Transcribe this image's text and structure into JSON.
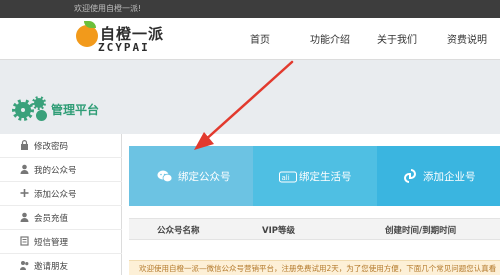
{
  "topbar": {
    "welcome": "欢迎使用自橙一派!"
  },
  "logo": {
    "name_cn": "自橙一派",
    "name_en": "ZCYPAI"
  },
  "nav": [
    "首页",
    "功能介绍",
    "关于我们",
    "资费说明"
  ],
  "panel": {
    "title": "管理平台"
  },
  "sidebar": {
    "items": [
      {
        "label": "修改密码",
        "icon": "lock-icon"
      },
      {
        "label": "我的公众号",
        "icon": "user-icon"
      },
      {
        "label": "添加公众号",
        "icon": "plus-icon"
      },
      {
        "label": "会员充值",
        "icon": "member-icon"
      },
      {
        "label": "短信管理",
        "icon": "sms-icon"
      },
      {
        "label": "邀请朋友",
        "icon": "invite-icon"
      }
    ]
  },
  "cards": [
    {
      "label": "绑定公众号",
      "icon": "wechat-icon",
      "color": "#6cc3e3"
    },
    {
      "label": "绑定生活号",
      "icon": "alipay-icon",
      "color": "#4fbfe3"
    },
    {
      "label": "添加企业号",
      "icon": "link-icon",
      "color": "#3ab5e0"
    }
  ],
  "table": {
    "headers": [
      "公众号名称",
      "VIP等级",
      "创建时间/到期时间"
    ]
  },
  "notice": {
    "text": "欢迎使用自橙一派—微信公众号营销平台，注册免费试用2天，为了您使用方便，下面几个常见问题您认真看"
  },
  "colors": {
    "accent": "#2f9d76",
    "arrow": "#e23a2e"
  }
}
